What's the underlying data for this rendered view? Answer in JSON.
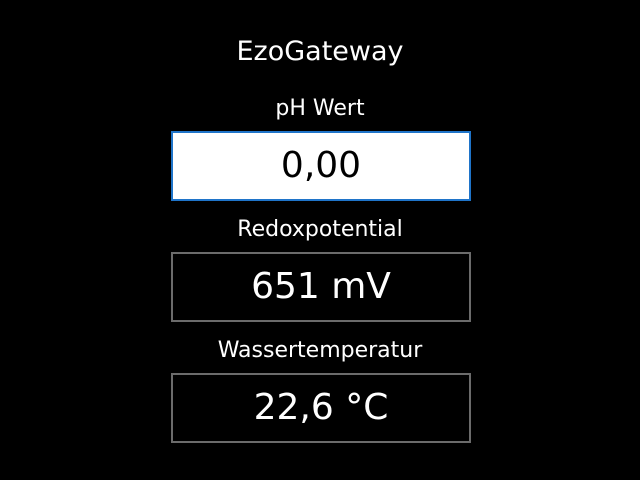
{
  "app": {
    "title": "EzoGateway"
  },
  "readings": {
    "ph": {
      "label": "pH Wert",
      "value": "0,00"
    },
    "redox": {
      "label": "Redoxpotential",
      "value": "651 mV"
    },
    "temperature": {
      "label": "Wassertemperatur",
      "value": "22,6 °C"
    }
  },
  "colors": {
    "background": "#000000",
    "text": "#ffffff",
    "focus_border": "#1f74c9",
    "box_border": "#6b6b6b",
    "focused_box_background": "#ffffff"
  }
}
